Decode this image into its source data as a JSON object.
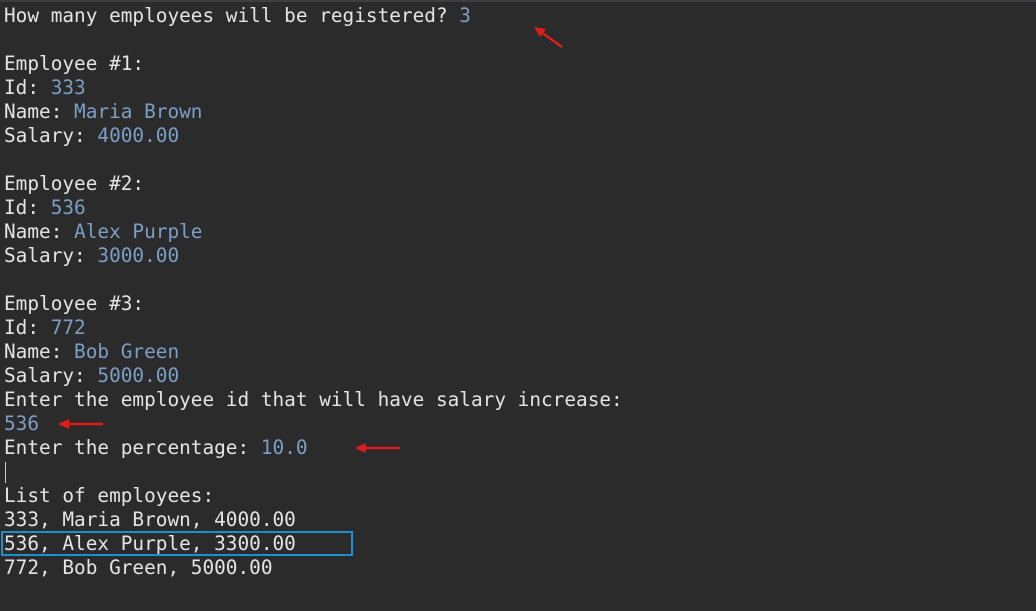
{
  "console": {
    "prompt_count": {
      "label": "How many employees will be registered? ",
      "value": "3"
    },
    "employees": [
      {
        "header": "Employee #1:",
        "id_label": "Id: ",
        "id": "333",
        "name_label": "Name: ",
        "name": "Maria Brown",
        "salary_label": "Salary: ",
        "salary": "4000.00"
      },
      {
        "header": "Employee #2:",
        "id_label": "Id: ",
        "id": "536",
        "name_label": "Name: ",
        "name": "Alex Purple",
        "salary_label": "Salary: ",
        "salary": "3000.00"
      },
      {
        "header": "Employee #3:",
        "id_label": "Id: ",
        "id": "772",
        "name_label": "Name: ",
        "name": "Bob Green",
        "salary_label": "Salary: ",
        "salary": "5000.00"
      }
    ],
    "increase_prompt": "Enter the employee id that will have salary increase:",
    "increase_id": "536",
    "percentage_prompt": {
      "label": "Enter the percentage: ",
      "value": "10.0"
    },
    "list_header": "List of employees:",
    "list": [
      "333, Maria Brown, 4000.00",
      "536, Alex Purple, 3300.00",
      "772, Bob Green, 5000.00"
    ]
  },
  "colors": {
    "background": "#2b2b2b",
    "text": "#e4e4e4",
    "user_input": "#7b9fc6",
    "annotation_arrow": "#e01b1b",
    "annotation_box": "#1c8fd2"
  },
  "annotations": {
    "arrow_icon": "red-arrow-icon",
    "box": "highlight-box"
  }
}
